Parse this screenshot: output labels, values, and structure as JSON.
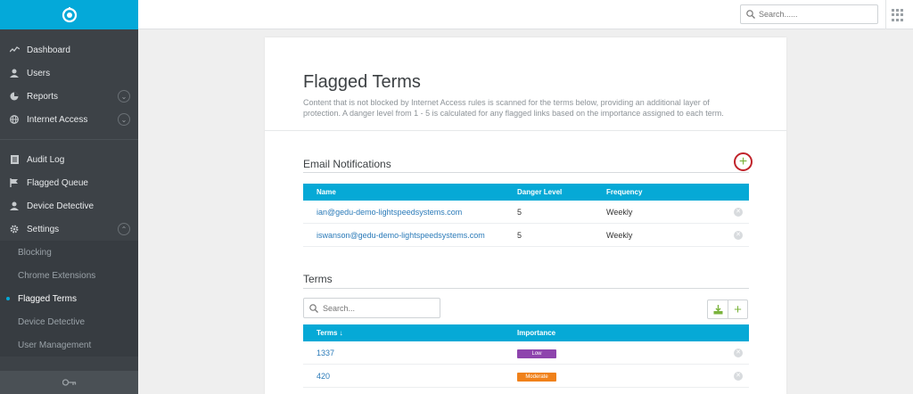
{
  "sidebar": {
    "items": [
      {
        "label": "Dashboard",
        "icon": "chart-line-icon"
      },
      {
        "label": "Users",
        "icon": "user-icon"
      },
      {
        "label": "Reports",
        "icon": "pie-chart-icon"
      },
      {
        "label": "Internet Access",
        "icon": "globe-icon"
      }
    ],
    "items2": [
      {
        "label": "Audit Log",
        "icon": "list-icon"
      },
      {
        "label": "Flagged Queue",
        "icon": "flag-icon"
      },
      {
        "label": "Device Detective",
        "icon": "user-icon"
      },
      {
        "label": "Settings",
        "icon": "gear-icon"
      }
    ],
    "sub": [
      {
        "label": "Blocking"
      },
      {
        "label": "Chrome Extensions"
      },
      {
        "label": "Flagged Terms"
      },
      {
        "label": "Device Detective"
      },
      {
        "label": "User Management"
      }
    ]
  },
  "topbar": {
    "search_placeholder": "Search......"
  },
  "page": {
    "title": "Flagged Terms",
    "description": "Content that is not blocked by Internet Access rules is scanned for the terms below, providing an additional layer of protection. A danger level from 1 - 5 is calculated for any flagged links based on the importance assigned to each term."
  },
  "email": {
    "title": "Email Notifications",
    "headers": {
      "name": "Name",
      "danger": "Danger Level",
      "frequency": "Frequency"
    },
    "rows": [
      {
        "email": "ian@gedu-demo-lightspeedsystems.com",
        "danger": "5",
        "frequency": "Weekly"
      },
      {
        "email": "iswanson@gedu-demo-lightspeedsystems.com",
        "danger": "5",
        "frequency": "Weekly"
      }
    ]
  },
  "terms": {
    "title": "Terms",
    "search_placeholder": "Search...",
    "headers": {
      "term": "Terms ↓",
      "importance": "Importance"
    },
    "rows": [
      {
        "term": "1337",
        "importance": "Low",
        "color": "#8e44ad"
      },
      {
        "term": "420",
        "importance": "Moderate",
        "color": "#f0811a"
      }
    ]
  },
  "colors": {
    "accent": "#04a9d9",
    "add": "#7ab33c",
    "highlight": "#c0232a"
  }
}
